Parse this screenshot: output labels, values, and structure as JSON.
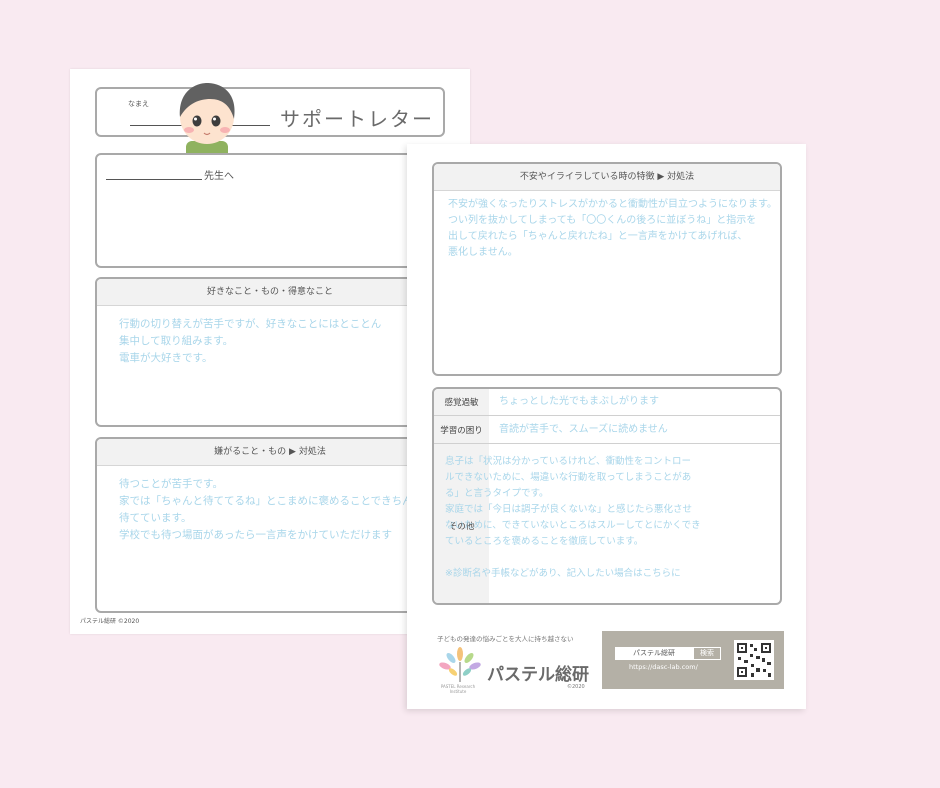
{
  "sheet1": {
    "name_label": "なまえ",
    "title": "サポートレター",
    "teacher_suffix": "先生へ",
    "likes": {
      "heading": "好きなこと・もの・得意なこと",
      "text": "行動の切り替えが苦手ですが、好きなことにはとことん\n集中して取り組みます。\n電車が大好きです。"
    },
    "dislikes": {
      "heading": "嫌がること・もの ▶ 対処法",
      "text": "待つことが苦手です。\n家では「ちゃんと待ててるね」とこまめに褒めることできちん\n待てています。\n学校でも待つ場面があったら一言声をかけていただけます"
    },
    "footer_logo": "パステル総研 ©2020"
  },
  "sheet2": {
    "anxiety": {
      "heading": "不安やイライラしている時の特徴 ▶ 対処法",
      "text": "不安が強くなったりストレスがかかると衝動性が目立つようになります。\nつい列を抜かしてしまっても「〇〇くんの後ろに並ぼうね」と指示を\n出して戻れたら「ちゃんと戻れたね」と一言声をかけてあげれば、\n悪化しません。"
    },
    "table": [
      {
        "label": "感覚過敏",
        "value": "ちょっとした光でもまぶしがります"
      },
      {
        "label": "学習の困り",
        "value": "音読が苦手で、スムーズに読めません"
      },
      {
        "label": "その他",
        "value": "息子は「状況は分かっているけれど、衝動性をコントロー\nルできないために、場違いな行動を取ってしまうことがあ\nる」と言うタイプです。\n家庭では「今日は調子が良くないな」と感じたら悪化させ\nないために、できていないところはスルーしてとにかくでき\nているところを褒めることを徹底しています。\n\n※診断名や手帳などがあり、記入したい場合はこちらに"
      }
    ],
    "footer": {
      "tagline": "子どもの発達の悩みごとを大人に持ち越さない",
      "brand": "パステル総研",
      "brand_sub": "PASTEL Research Institute",
      "copyright": "©2020",
      "search_text": "パステル総研",
      "search_button": "検索",
      "url": "https://dasc-lab.com/"
    }
  },
  "colors": {
    "background": "#f9eaf1",
    "border": "#a9a9a9",
    "text_blue": "#a9d6ea",
    "search_panel": "#b4b0a6"
  }
}
